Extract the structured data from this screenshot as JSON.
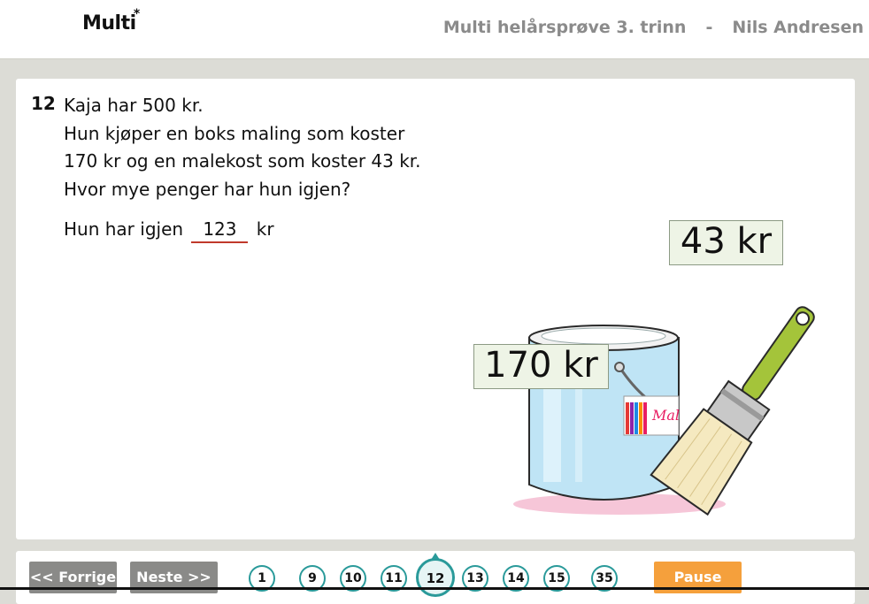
{
  "header": {
    "logo_text": "Multi",
    "logo_star": "*",
    "test_title": "Multi helårsprøve 3. trinn",
    "separator": "-",
    "student_name": "Nils Andresen"
  },
  "task": {
    "number": "12",
    "lines": [
      "Kaja har 500 kr.",
      "Hun kjøper en boks maling som koster",
      "170 kr og en malekost som koster 43 kr.",
      "Hvor mye penger har hun igjen?"
    ],
    "answer_prefix": "Hun har igjen",
    "answer_value": "123",
    "answer_suffix": "kr"
  },
  "illustration": {
    "bucket_price": "170 kr",
    "brush_price": "43 kr",
    "bucket_label": "Mal",
    "icon": "paint-bucket-and-brush"
  },
  "nav": {
    "prev_label": "<< Forrige",
    "next_label": "Neste >>",
    "pause_label": "Pause",
    "pages": [
      "1",
      "9",
      "10",
      "11",
      "12",
      "13",
      "14",
      "15",
      "35"
    ],
    "current_page": "12"
  },
  "colors": {
    "accent": "#2a9a9a",
    "pause": "#f5a03c",
    "answer_underline": "#c0392b",
    "background": "#dcdcd6"
  }
}
